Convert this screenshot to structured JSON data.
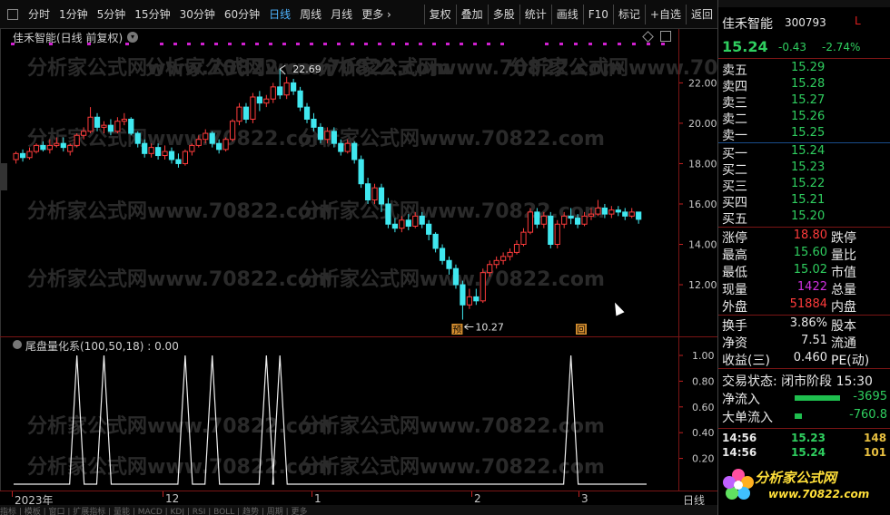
{
  "toolbar": {
    "left_items": [
      {
        "label": "分时",
        "active": false
      },
      {
        "label": "1分钟",
        "active": false
      },
      {
        "label": "5分钟",
        "active": false
      },
      {
        "label": "15分钟",
        "active": false
      },
      {
        "label": "30分钟",
        "active": false
      },
      {
        "label": "60分钟",
        "active": false
      },
      {
        "label": "日线",
        "active": true
      },
      {
        "label": "周线",
        "active": false
      },
      {
        "label": "月线",
        "active": false
      },
      {
        "label": "更多",
        "active": false
      }
    ],
    "right_items": [
      "复权",
      "叠加",
      "多股",
      "统计",
      "画线",
      "F10",
      "标记",
      "+自选",
      "返回"
    ]
  },
  "chart": {
    "title": "佳禾智能(日线 前复权)",
    "high_label": "22.69",
    "low_label": "10.27",
    "marker_yu": "预",
    "marker_hui": "回",
    "y_ticks": [
      "22.00",
      "20.00",
      "18.00",
      "16.00",
      "14.00",
      "12.00"
    ],
    "watermark": "分析家公式网www.70822.com"
  },
  "indicator": {
    "title": "尾盘量化系(100,50,18) : 0.00",
    "y_ticks": [
      "1.00",
      "0.80",
      "0.60",
      "0.40",
      "0.20"
    ]
  },
  "xaxis": {
    "labels": [
      "2023年",
      "12",
      "1",
      "2",
      "3"
    ],
    "corner": "日线"
  },
  "bottom_strip": "指标 | 模板 | 窗口 | 扩展指标 | 量能 | MACD | KDJ | RSI | BOLL | 趋势 | 周期 | 更多",
  "chart_data": {
    "type": "candlestick",
    "description_note": "",
    "y_range": [
      10,
      23.2
    ],
    "annotated_high": 22.69,
    "annotated_low": 10.27,
    "candles": [
      [
        18.2,
        18.5,
        18.6,
        18.0
      ],
      [
        18.5,
        18.3,
        18.7,
        18.1
      ],
      [
        18.3,
        18.6,
        18.8,
        18.2
      ],
      [
        18.6,
        18.9,
        19.0,
        18.5
      ],
      [
        18.9,
        18.7,
        19.1,
        18.6
      ],
      [
        18.7,
        18.9,
        19.2,
        18.5
      ],
      [
        18.9,
        19.0,
        19.3,
        18.8
      ],
      [
        19.0,
        18.8,
        19.3,
        18.6
      ],
      [
        18.6,
        18.9,
        19.0,
        18.4
      ],
      [
        18.9,
        19.4,
        19.5,
        18.8
      ],
      [
        19.4,
        19.6,
        19.8,
        19.2
      ],
      [
        19.6,
        20.3,
        20.8,
        19.5
      ],
      [
        20.3,
        19.8,
        20.5,
        19.6
      ],
      [
        19.8,
        19.9,
        20.1,
        19.5
      ],
      [
        19.9,
        19.6,
        20.2,
        19.4
      ],
      [
        19.6,
        20.1,
        20.3,
        19.5
      ],
      [
        20.1,
        20.2,
        20.5,
        19.9
      ],
      [
        20.2,
        19.5,
        20.3,
        19.4
      ],
      [
        19.5,
        19.0,
        19.6,
        18.8
      ],
      [
        19.0,
        18.5,
        19.2,
        18.3
      ],
      [
        18.5,
        18.8,
        19.0,
        18.3
      ],
      [
        18.8,
        18.4,
        19.0,
        18.2
      ],
      [
        18.4,
        18.6,
        18.9,
        18.2
      ],
      [
        18.6,
        18.2,
        18.8,
        18.0
      ],
      [
        18.2,
        18.0,
        18.5,
        17.8
      ],
      [
        18.0,
        18.6,
        18.7,
        17.9
      ],
      [
        18.6,
        18.9,
        19.0,
        18.4
      ],
      [
        18.9,
        19.2,
        19.4,
        18.8
      ],
      [
        19.2,
        19.5,
        19.7,
        19.0
      ],
      [
        19.5,
        19.0,
        19.6,
        18.8
      ],
      [
        19.0,
        18.7,
        19.2,
        18.5
      ],
      [
        18.7,
        19.2,
        19.3,
        18.6
      ],
      [
        19.2,
        20.1,
        20.2,
        19.1
      ],
      [
        20.1,
        20.8,
        21.0,
        19.9
      ],
      [
        20.8,
        20.2,
        21.0,
        20.0
      ],
      [
        20.2,
        21.3,
        21.5,
        20.0
      ],
      [
        21.3,
        21.0,
        21.6,
        20.6
      ],
      [
        21.0,
        21.2,
        21.4,
        20.8
      ],
      [
        21.2,
        21.8,
        22.0,
        21.0
      ],
      [
        21.8,
        21.4,
        22.69,
        21.2
      ],
      [
        21.4,
        22.0,
        22.3,
        21.2
      ],
      [
        22.0,
        21.6,
        22.2,
        21.4
      ],
      [
        21.6,
        20.8,
        21.8,
        20.6
      ],
      [
        20.8,
        20.2,
        21.0,
        20.0
      ],
      [
        20.2,
        19.8,
        20.5,
        19.6
      ],
      [
        19.8,
        19.2,
        20.0,
        19.0
      ],
      [
        19.2,
        19.6,
        19.8,
        19.0
      ],
      [
        19.6,
        19.0,
        19.8,
        18.8
      ],
      [
        19.0,
        18.6,
        19.2,
        18.4
      ],
      [
        18.6,
        19.0,
        19.2,
        18.5
      ],
      [
        19.0,
        18.2,
        19.1,
        18.0
      ],
      [
        18.2,
        17.0,
        18.4,
        16.8
      ],
      [
        17.0,
        16.2,
        17.3,
        16.0
      ],
      [
        16.2,
        16.8,
        17.0,
        16.0
      ],
      [
        16.8,
        16.0,
        17.0,
        15.6
      ],
      [
        16.0,
        15.0,
        16.3,
        14.8
      ],
      [
        15.0,
        14.8,
        15.3,
        14.6
      ],
      [
        14.8,
        15.2,
        15.4,
        14.6
      ],
      [
        15.2,
        14.9,
        15.5,
        14.7
      ],
      [
        14.9,
        15.4,
        15.6,
        14.8
      ],
      [
        15.4,
        15.0,
        15.6,
        14.8
      ],
      [
        15.0,
        14.5,
        15.2,
        14.2
      ],
      [
        14.5,
        13.8,
        14.6,
        13.6
      ],
      [
        13.8,
        13.2,
        14.0,
        13.0
      ],
      [
        13.2,
        12.8,
        13.4,
        12.5
      ],
      [
        12.8,
        12.0,
        13.0,
        11.8
      ],
      [
        12.0,
        11.0,
        12.2,
        10.27
      ],
      [
        11.0,
        11.4,
        11.8,
        10.8
      ],
      [
        11.4,
        11.2,
        11.8,
        11.0
      ],
      [
        11.2,
        12.6,
        12.8,
        11.1
      ],
      [
        12.6,
        13.0,
        13.2,
        12.4
      ],
      [
        13.0,
        13.2,
        13.4,
        12.8
      ],
      [
        13.2,
        13.4,
        13.6,
        13.0
      ],
      [
        13.4,
        13.6,
        13.8,
        13.2
      ],
      [
        13.6,
        14.0,
        14.2,
        13.5
      ],
      [
        14.0,
        14.6,
        14.8,
        13.9
      ],
      [
        14.6,
        15.6,
        15.8,
        14.5
      ],
      [
        15.6,
        15.0,
        15.8,
        14.8
      ],
      [
        15.0,
        15.4,
        15.6,
        14.8
      ],
      [
        15.4,
        14.0,
        15.6,
        13.8
      ],
      [
        14.0,
        15.0,
        15.2,
        13.8
      ],
      [
        15.0,
        15.4,
        15.6,
        14.8
      ],
      [
        15.4,
        15.3,
        15.8,
        15.0
      ],
      [
        15.3,
        15.0,
        15.5,
        14.8
      ],
      [
        15.0,
        15.4,
        15.6,
        14.9
      ],
      [
        15.4,
        15.5,
        15.8,
        15.2
      ],
      [
        15.5,
        15.8,
        16.2,
        15.4
      ],
      [
        15.8,
        15.5,
        16.0,
        15.3
      ],
      [
        15.5,
        15.7,
        15.9,
        15.3
      ],
      [
        15.7,
        15.6,
        15.9,
        15.4
      ],
      [
        15.6,
        15.4,
        15.8,
        15.2
      ],
      [
        15.4,
        15.6,
        15.8,
        15.3
      ],
      [
        15.6,
        15.24,
        15.6,
        15.02
      ]
    ],
    "indicator_spikes_x_index": [
      9,
      13,
      25,
      29,
      37,
      39,
      82
    ],
    "indicator_value_range": [
      0,
      1
    ]
  },
  "panel": {
    "name": "佳禾智能",
    "code": "300793",
    "mark": "L",
    "price": "15.24",
    "change": "-0.43",
    "change_pct": "-2.74%",
    "sell": [
      {
        "label": "卖五",
        "price": "15.29"
      },
      {
        "label": "卖四",
        "price": "15.28"
      },
      {
        "label": "卖三",
        "price": "15.27"
      },
      {
        "label": "卖二",
        "price": "15.26"
      },
      {
        "label": "卖一",
        "price": "15.25"
      }
    ],
    "buy": [
      {
        "label": "买一",
        "price": "15.24"
      },
      {
        "label": "买二",
        "price": "15.23"
      },
      {
        "label": "买三",
        "price": "15.22"
      },
      {
        "label": "买四",
        "price": "15.21"
      },
      {
        "label": "买五",
        "price": "15.20"
      }
    ],
    "stats": [
      {
        "label": "涨停",
        "value": "18.80",
        "color": "red",
        "label2": "跌停"
      },
      {
        "label": "最高",
        "value": "15.60",
        "color": "green",
        "label2": "量比"
      },
      {
        "label": "最低",
        "value": "15.02",
        "color": "green",
        "label2": "市值"
      },
      {
        "label": "现量",
        "value": "1422",
        "color": "purple",
        "label2": "总量"
      },
      {
        "label": "外盘",
        "value": "51884",
        "color": "red",
        "label2": "内盘"
      }
    ],
    "stats2": [
      {
        "label": "换手",
        "value": "3.86%",
        "label2": "股本"
      },
      {
        "label": "净资",
        "value": "7.51",
        "label2": "流通"
      },
      {
        "label": "收益(三)",
        "value": "0.460",
        "label2": "PE(动)"
      }
    ],
    "trade_status": "交易状态: 闭市阶段 15:30",
    "net_inflow_label": "净流入",
    "net_inflow_value": "-3695",
    "big_inflow_label": "大单流入",
    "big_inflow_value": "-760.8",
    "ticks": [
      {
        "time": "14:56",
        "price": "15.23",
        "qty": "148"
      },
      {
        "time": "14:56",
        "price": "15.24",
        "qty": "101"
      }
    ],
    "logo_text": "分析家公式网",
    "logo_url": "www.70822.com"
  }
}
